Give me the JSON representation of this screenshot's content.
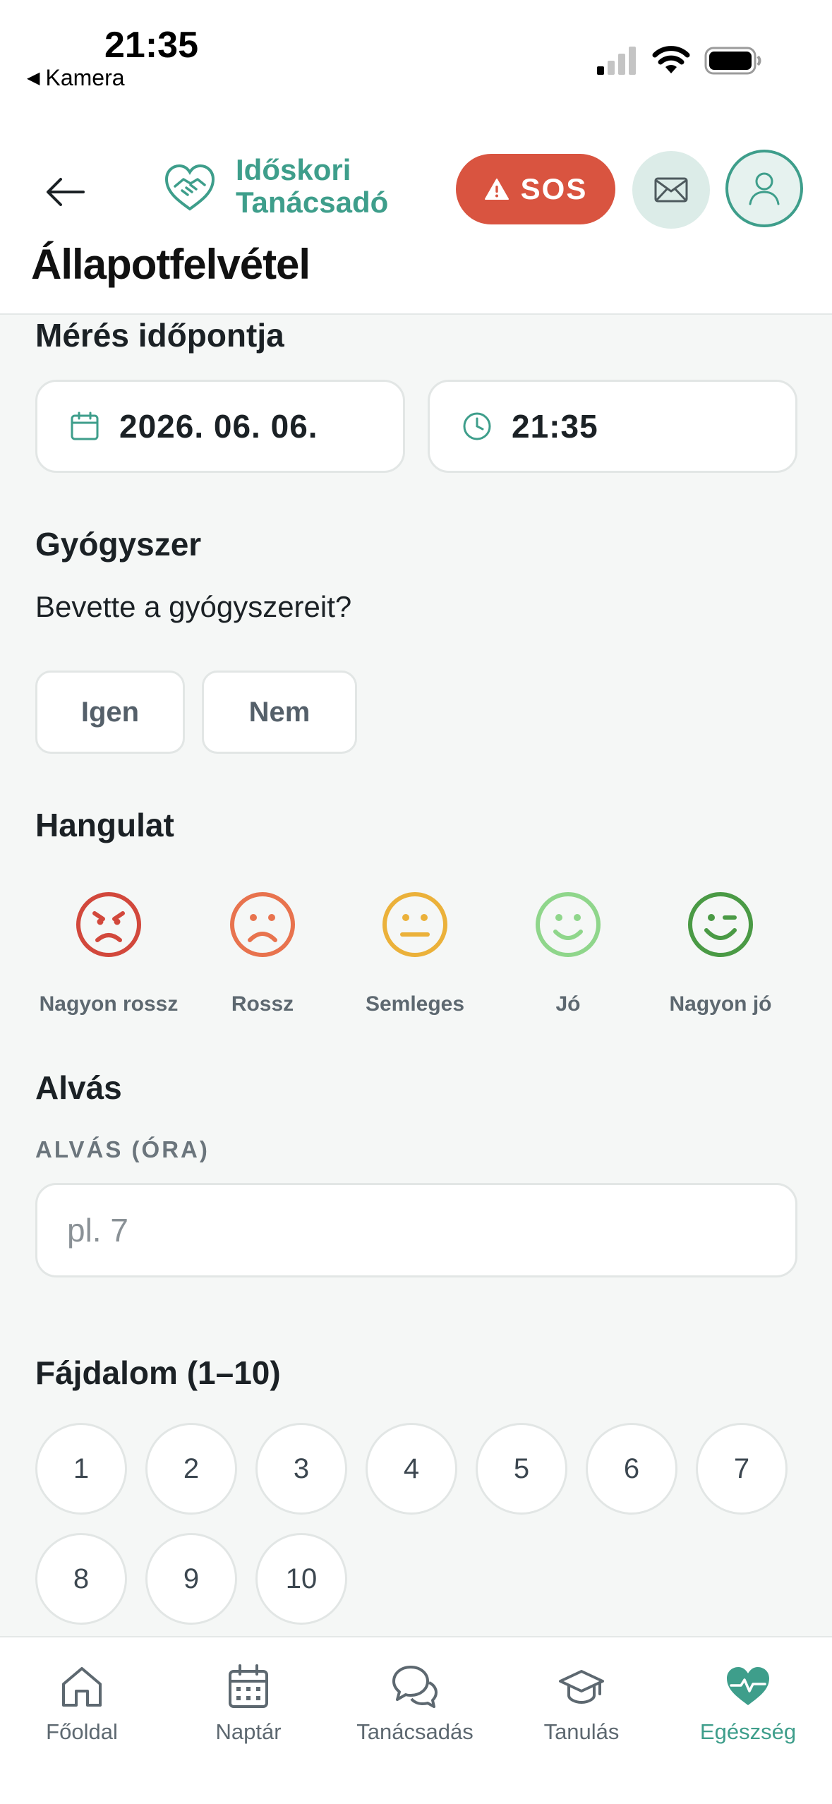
{
  "status_bar": {
    "time": "21:35",
    "back_app": "Kamera"
  },
  "header": {
    "logo_line1": "Időskori",
    "logo_line2": "Tanácsadó",
    "sos_label": "SOS"
  },
  "page_title": "Állapotfelvétel",
  "measurement": {
    "section_title": "Mérés időpontja",
    "date": "2026. 06. 06.",
    "time": "21:35"
  },
  "medication": {
    "section_title": "Gyógyszer",
    "question": "Bevette a gyógyszereit?",
    "yes_label": "Igen",
    "no_label": "Nem"
  },
  "mood": {
    "section_title": "Hangulat",
    "options": [
      {
        "label": "Nagyon rossz",
        "color": "#d2483c"
      },
      {
        "label": "Rossz",
        "color": "#e8734e"
      },
      {
        "label": "Semleges",
        "color": "#ebb13a"
      },
      {
        "label": "Jó",
        "color": "#8fd68b"
      },
      {
        "label": "Nagyon jó",
        "color": "#4a9a45"
      }
    ]
  },
  "sleep": {
    "section_title": "Alvás",
    "field_label": "ALVÁS (ÓRA)",
    "placeholder": "pl. 7"
  },
  "pain": {
    "section_title": "Fájdalom (1–10)",
    "values": [
      "1",
      "2",
      "3",
      "4",
      "5",
      "6",
      "7",
      "8",
      "9",
      "10"
    ]
  },
  "tabs": [
    {
      "label": "Főoldal",
      "icon": "home-icon"
    },
    {
      "label": "Naptár",
      "icon": "calendar-icon"
    },
    {
      "label": "Tanácsadás",
      "icon": "chat-icon"
    },
    {
      "label": "Tanulás",
      "icon": "graduation-cap-icon"
    },
    {
      "label": "Egészség",
      "icon": "heart-pulse-icon",
      "active": true
    }
  ],
  "colors": {
    "accent": "#3e9e8b",
    "sos": "#d95440"
  }
}
